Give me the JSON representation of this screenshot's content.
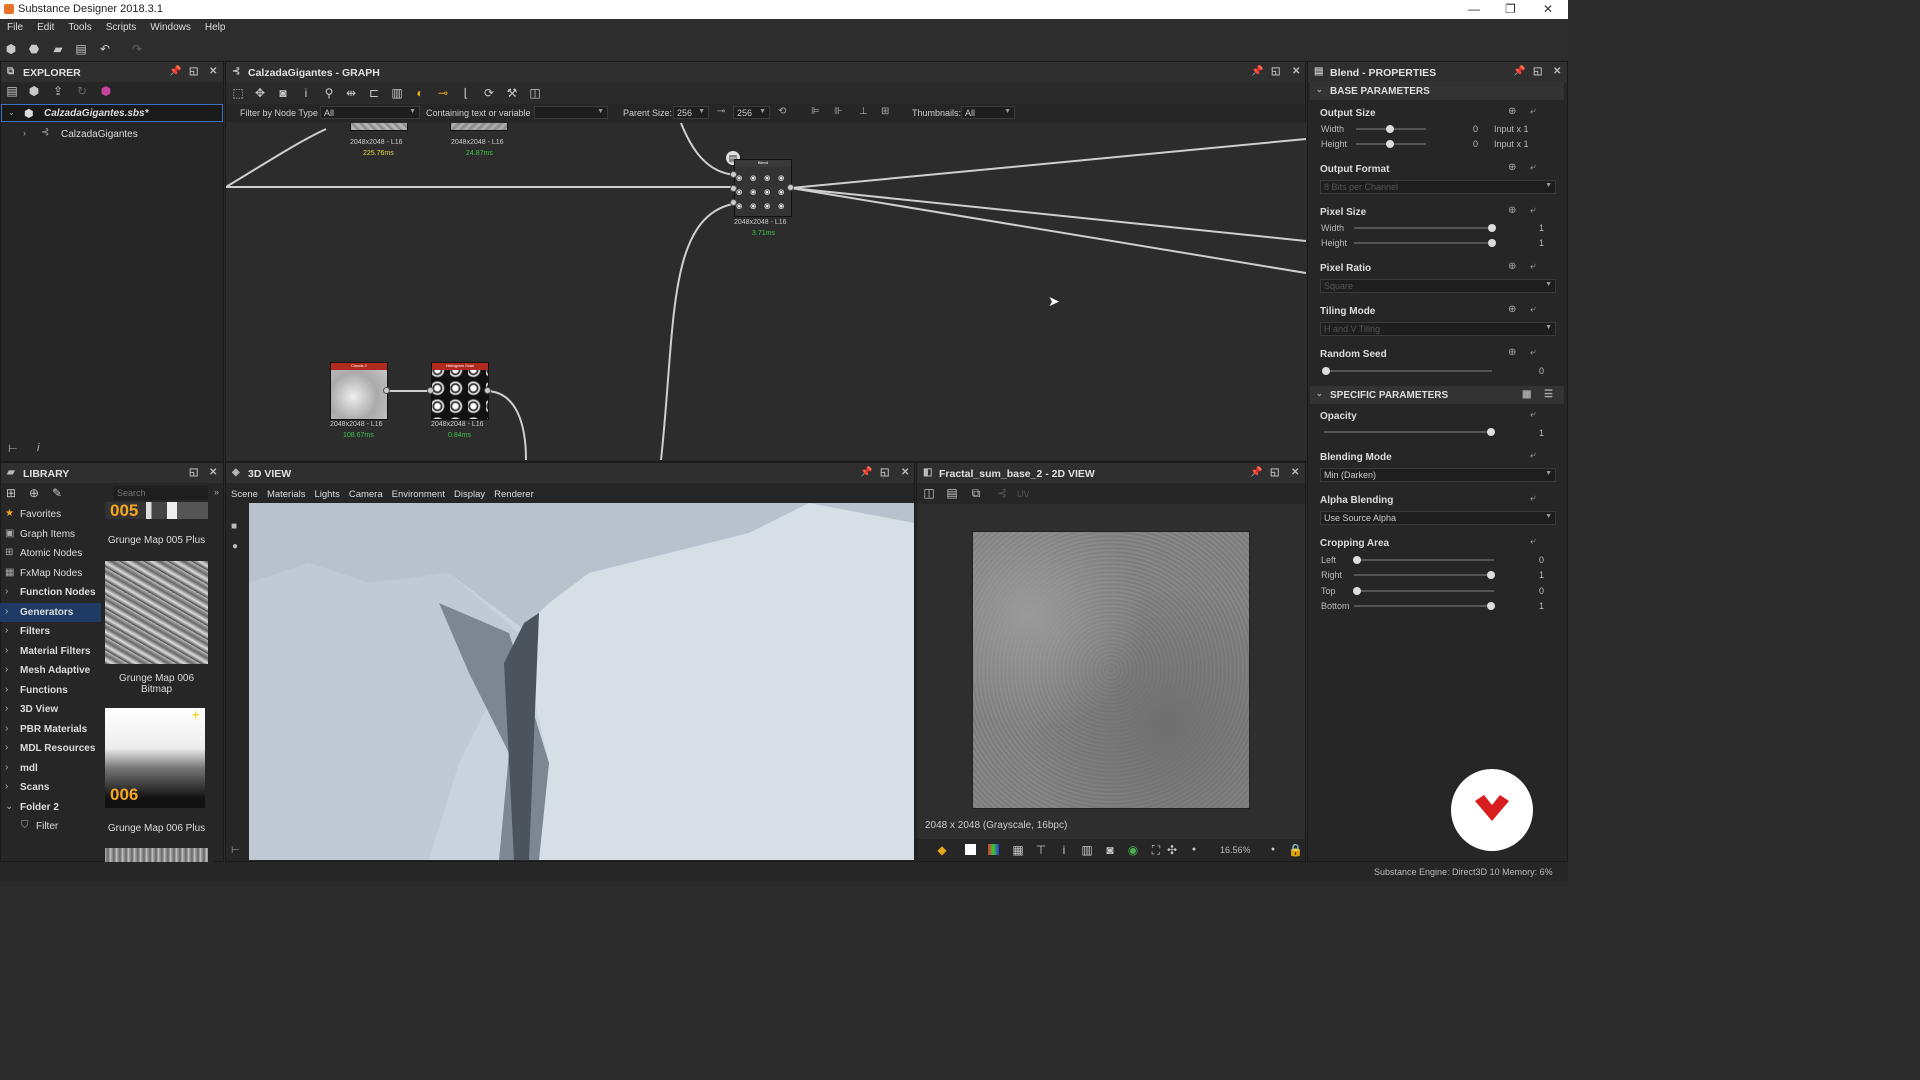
{
  "app": {
    "title": "Substance Designer 2018.3.1"
  },
  "menu": [
    "File",
    "Edit",
    "Tools",
    "Scripts",
    "Windows",
    "Help"
  ],
  "explorer": {
    "title": "EXPLORER",
    "package": "CalzadaGigantes.sbs*",
    "graph": "CalzadaGigantes"
  },
  "graph": {
    "title": "CalzadaGigantes - GRAPH",
    "filter_label": "Filter by Node Type",
    "filter_value": "All",
    "containing_label": "Containing text or variable",
    "parent_size_label": "Parent Size:",
    "parent_size_a": "256",
    "parent_size_b": "256",
    "thumbnails_label": "Thumbnails:",
    "thumbnails_value": "All",
    "nodes": [
      {
        "caption": "2048x2048 - L16",
        "time": "225.76ms",
        "time_color": "#e8d84a"
      },
      {
        "caption": "2048x2048 - L16",
        "time": "24.87ms",
        "time_color": "#3fc24a"
      },
      {
        "caption": "2048x2048 - L16",
        "time": "3.71ms",
        "time_color": "#3fc24a",
        "head": "Blend"
      },
      {
        "caption": "2048x2048 - L16",
        "time": "108.67ms",
        "time_color": "#3fc24a",
        "head": "Clouds 2"
      },
      {
        "caption": "2048x2048 - L16",
        "time": "0.84ms",
        "time_color": "#3fc24a",
        "head": "Histogram Scan"
      }
    ]
  },
  "properties": {
    "title": "Blend - PROPERTIES",
    "base_section": "BASE PARAMETERS",
    "output_size": {
      "label": "Output Size",
      "width_label": "Width",
      "height_label": "Height",
      "width_value": "0",
      "height_value": "0",
      "width_mode": "Input x 1",
      "height_mode": "Input x 1"
    },
    "output_format": {
      "label": "Output Format",
      "value": "8 Bits per Channel"
    },
    "pixel_size": {
      "label": "Pixel Size",
      "width_label": "Width",
      "height_label": "Height",
      "width_value": "1",
      "height_value": "1"
    },
    "pixel_ratio": {
      "label": "Pixel Ratio",
      "value": "Square"
    },
    "tiling_mode": {
      "label": "Tiling Mode",
      "value": "H and V Tiling"
    },
    "random_seed": {
      "label": "Random Seed",
      "value": "0"
    },
    "specific_section": "SPECIFIC PARAMETERS",
    "opacity": {
      "label": "Opacity",
      "value": "1",
      "level": 1
    },
    "blending_mode": {
      "label": "Blending Mode",
      "value": "Min (Darken)"
    },
    "alpha_blending": {
      "label": "Alpha Blending",
      "value": "Use Source Alpha"
    },
    "cropping": {
      "label": "Cropping Area",
      "rows": [
        {
          "label": "Left",
          "value": "0"
        },
        {
          "label": "Right",
          "value": "1"
        },
        {
          "label": "Top",
          "value": "0"
        },
        {
          "label": "Bottom",
          "value": "1"
        }
      ]
    }
  },
  "library": {
    "title": "LIBRARY",
    "search_placeholder": "Search",
    "items": [
      {
        "label": "Favorites",
        "icon": "star-icon",
        "glyph": "★"
      },
      {
        "label": "Graph Items",
        "icon": "graph-items-icon",
        "glyph": "▣"
      },
      {
        "label": "Atomic Nodes",
        "icon": "atomic-nodes-icon",
        "glyph": "⊞"
      },
      {
        "label": "FxMap Nodes",
        "icon": "fxmap-nodes-icon",
        "glyph": "▦"
      },
      {
        "label": "Function Nodes",
        "icon": "chevron-right-icon",
        "glyph": "›"
      },
      {
        "label": "Generators",
        "icon": "chevron-right-icon",
        "glyph": "›"
      },
      {
        "label": "Filters",
        "icon": "chevron-right-icon",
        "glyph": "›"
      },
      {
        "label": "Material Filters",
        "icon": "chevron-right-icon",
        "glyph": "›"
      },
      {
        "label": "Mesh Adaptive",
        "icon": "chevron-right-icon",
        "glyph": "›"
      },
      {
        "label": "Functions",
        "icon": "chevron-right-icon",
        "glyph": "›"
      },
      {
        "label": "3D View",
        "icon": "chevron-right-icon",
        "glyph": "›"
      },
      {
        "label": "PBR Materials",
        "icon": "chevron-right-icon",
        "glyph": "›"
      },
      {
        "label": "MDL Resources",
        "icon": "chevron-right-icon",
        "glyph": "›"
      },
      {
        "label": "mdl",
        "icon": "chevron-right-icon",
        "glyph": "›"
      },
      {
        "label": "Scans",
        "icon": "chevron-right-icon",
        "glyph": "›"
      },
      {
        "label": "Folder 2",
        "icon": "chevron-down-icon",
        "glyph": "⌄"
      },
      {
        "label": "Filter",
        "icon": "filter-icon",
        "glyph": "⛉"
      }
    ],
    "thumbs": [
      {
        "badge": "005",
        "caption": "Grunge Map 005 Plus"
      },
      {
        "caption": "Grunge Map 006 Bitmap"
      },
      {
        "badge": "006",
        "caption": "Grunge Map 006 Plus"
      }
    ]
  },
  "view3d": {
    "title": "3D VIEW",
    "tabs": [
      "Scene",
      "Materials",
      "Lights",
      "Camera",
      "Environment",
      "Display",
      "Renderer"
    ]
  },
  "view2d": {
    "title": "Fractal_sum_base_2 - 2D VIEW",
    "uv_label": "UV",
    "info": "2048 x 2048 (Grayscale, 16bpc)",
    "zoom": "16.56%"
  },
  "status": {
    "engine": "Substance Engine: Direct3D 10  Memory: 6%"
  }
}
